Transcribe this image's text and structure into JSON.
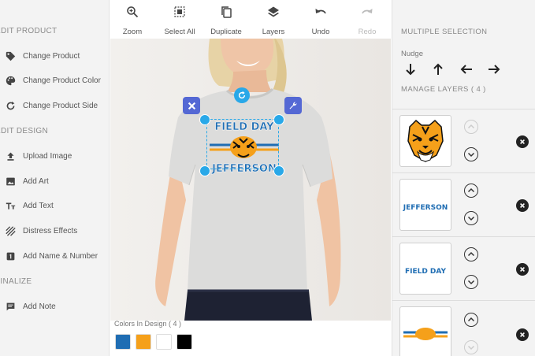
{
  "left_panel": {
    "edit_product_heading": "EDIT PRODUCT",
    "change_product": "Change Product",
    "change_product_color": "Change Product Color",
    "change_product_side": "Change Product Side",
    "edit_design_heading": "EDIT DESIGN",
    "upload_image": "Upload Image",
    "add_art": "Add Art",
    "add_text": "Add Text",
    "distress_effects": "Distress Effects",
    "add_name_number": "Add Name & Number",
    "finalize_heading": "FINALIZE",
    "add_note": "Add Note"
  },
  "toolbar": {
    "zoom": "Zoom",
    "select_all": "Select All",
    "duplicate": "Duplicate",
    "layers": "Layers",
    "undo": "Undo",
    "redo": "Redo"
  },
  "design": {
    "top_text": "FIELD DAY",
    "bottom_text": "JEFFERSON"
  },
  "colors": {
    "label": "Colors In Design ( 4 )",
    "swatches": [
      "#1f6db3",
      "#f5a01a",
      "#ffffff",
      "#000000"
    ]
  },
  "right_panel": {
    "multiple_selection_title": "MULTIPLE SELECTION",
    "nudge_label": "Nudge",
    "manage_layers_title": "MANAGE LAYERS ( 4 )",
    "layer_texts": {
      "jefferson": "JEFFERSON",
      "field_day": "FIELD DAY"
    }
  },
  "theme": {
    "accent_blue": "#1f6db3",
    "handle_blue": "#29a8e8",
    "control_purple": "#5468d4",
    "tiger_orange": "#f5a01a"
  }
}
